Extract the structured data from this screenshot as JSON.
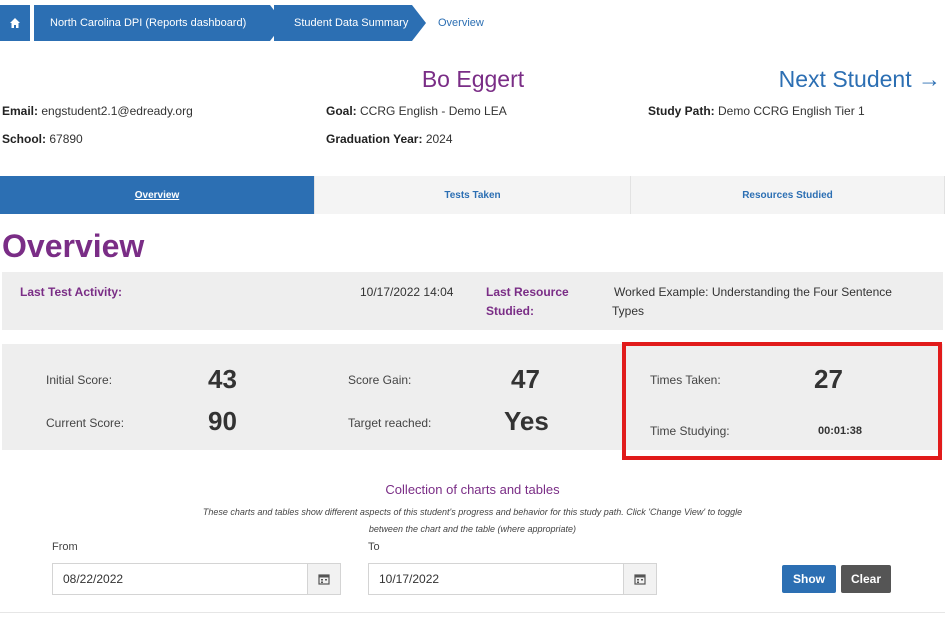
{
  "breadcrumb": {
    "items": [
      "North Carolina DPI (Reports dashboard)",
      "Student Data Summary"
    ],
    "current": "Overview"
  },
  "student": {
    "name": "Bo Eggert",
    "next_label": "Next Student →",
    "email_label": "Email:",
    "email": "engstudent2.1@edready.org",
    "goal_label": "Goal:",
    "goal": "CCRG English - Demo LEA",
    "study_path_label": "Study Path:",
    "study_path": "Demo CCRG English Tier 1",
    "school_label": "School:",
    "school": "67890",
    "grad_label": "Graduation Year:",
    "grad_year": "2024"
  },
  "tabs": [
    "Overview",
    "Tests Taken",
    "Resources Studied"
  ],
  "section_title": "Overview",
  "activity": {
    "last_test_label": "Last Test Activity:",
    "last_test_value": "10/17/2022 14:04",
    "last_resource_label_1": "Last Resource",
    "last_resource_label_2": "Studied:",
    "last_resource_value_1": "Worked Example: Understanding the Four Sentence",
    "last_resource_value_2": "Types"
  },
  "scores": {
    "initial_label": "Initial Score:",
    "initial": "43",
    "current_label": "Current Score:",
    "current": "90",
    "gain_label": "Score Gain:",
    "gain": "47",
    "target_label": "Target reached:",
    "target": "Yes",
    "times_label": "Times Taken:",
    "times": "27",
    "studying_label": "Time Studying:",
    "studying": "00:01:38"
  },
  "collection": {
    "title": "Collection of charts and tables",
    "desc_1": "These charts and tables show different aspects of this student's progress and behavior for this study path. Click 'Change View' to toggle",
    "desc_2": "between the chart and the table (where appropriate)"
  },
  "filters": {
    "from_label": "From",
    "from_value": "08/22/2022",
    "to_label": "To",
    "to_value": "10/17/2022",
    "show_label": "Show",
    "clear_label": "Clear"
  },
  "colors": {
    "primary_blue": "#2c6fb3",
    "purple": "#7a2d86",
    "highlight_red": "#e11b1b",
    "panel_gray": "#eeeeee"
  }
}
